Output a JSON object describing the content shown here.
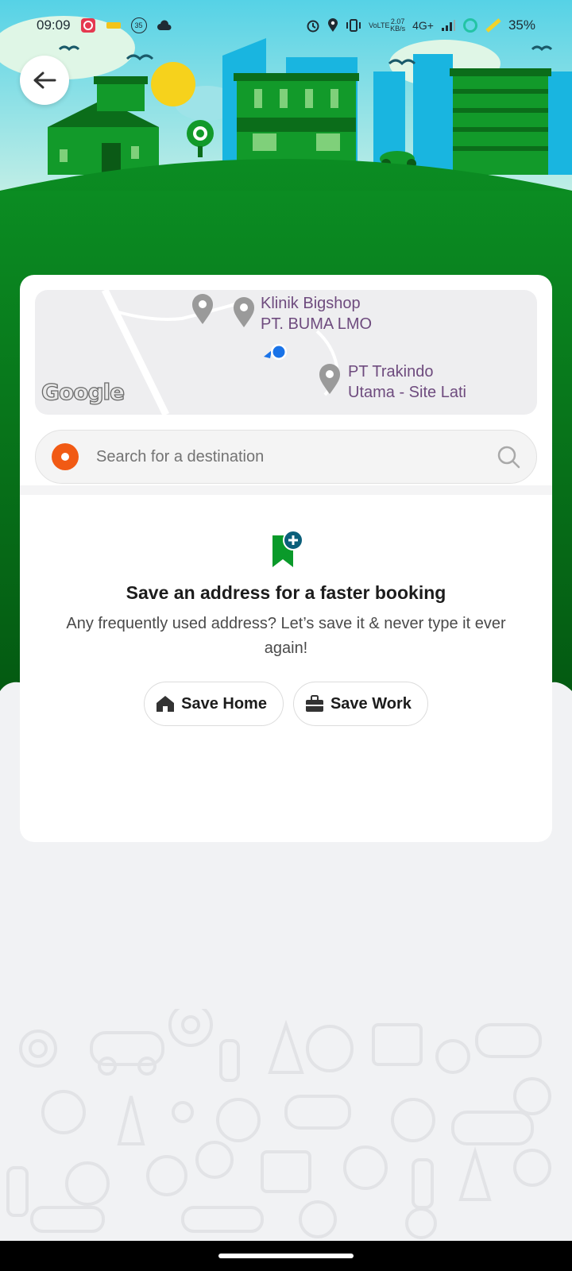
{
  "status_bar": {
    "time": "09:09",
    "notif_badge": "35",
    "net_speed_value": "2.07",
    "net_speed_unit": "KB/s",
    "volte": "VoLTE",
    "network": "4G+",
    "battery": "35%"
  },
  "map": {
    "labels": [
      "Klinik Bigshop",
      "PT. BUMA LMO",
      "PT Trakindo",
      "Utama - Site Lati"
    ],
    "attribution": "Google"
  },
  "search": {
    "placeholder": "Search for a destination"
  },
  "save_address": {
    "title": "Save an address for a faster booking",
    "description": "Any frequently used address? Let’s save it & never type it ever again!",
    "home_label": "Save Home",
    "work_label": "Save Work"
  },
  "colors": {
    "brand_green": "#0a8a1e",
    "origin_orange": "#f15a14",
    "sky": "#5fd0e8"
  }
}
